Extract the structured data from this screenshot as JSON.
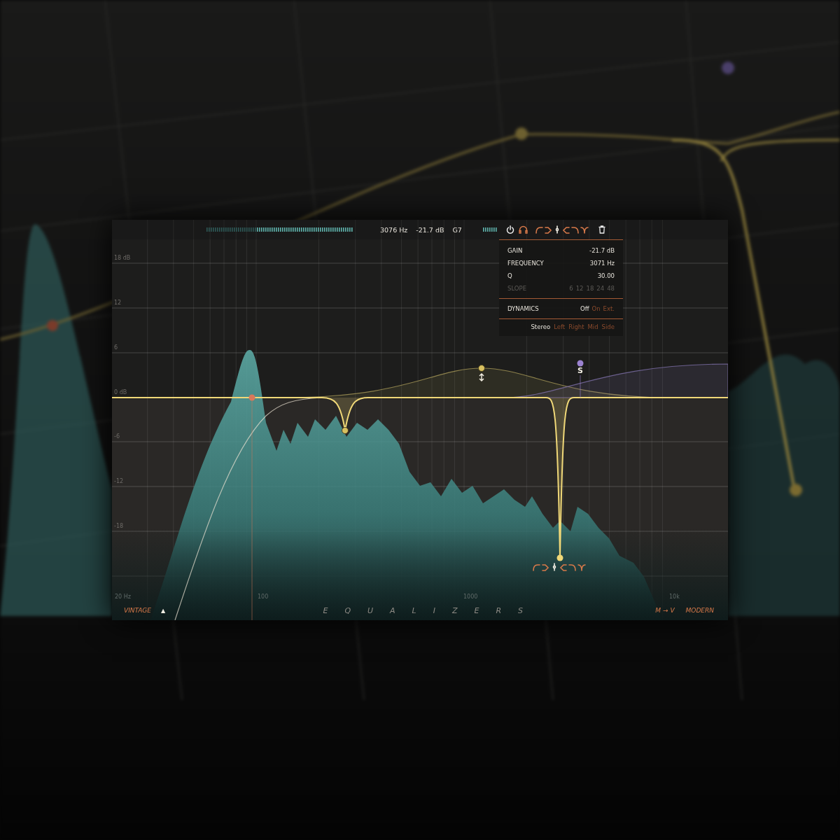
{
  "top_bar": {
    "readouts": [
      "3076 Hz",
      "-21.7 dB",
      "G7"
    ]
  },
  "filter_shapes": [
    {
      "kind": "low-cut",
      "selected": false
    },
    {
      "kind": "low-shelf",
      "selected": false
    },
    {
      "kind": "bell",
      "selected": true
    },
    {
      "kind": "high-shelf",
      "selected": false
    },
    {
      "kind": "high-cut",
      "selected": false
    },
    {
      "kind": "notch",
      "selected": false
    }
  ],
  "band_panel": {
    "rows": [
      {
        "label": "GAIN",
        "value": "-21.7 dB"
      },
      {
        "label": "FREQUENCY",
        "value": "3071 Hz"
      },
      {
        "label": "Q",
        "value": "30.00"
      }
    ],
    "slope": {
      "label": "SLOPE",
      "disabled": true,
      "options": [
        {
          "label": "6",
          "selected": false
        },
        {
          "label": "12",
          "selected": false
        },
        {
          "label": "18",
          "selected": false
        },
        {
          "label": "24",
          "selected": false
        },
        {
          "label": "48",
          "selected": false
        }
      ]
    },
    "dynamics": {
      "label": "DYNAMICS",
      "options": [
        {
          "label": "Off",
          "selected": true
        },
        {
          "label": "On",
          "selected": false
        },
        {
          "label": "Ext.",
          "selected": false
        }
      ]
    },
    "stereo": [
      {
        "label": "Stereo",
        "selected": true
      },
      {
        "label": "Left",
        "selected": false
      },
      {
        "label": "Right",
        "selected": false
      },
      {
        "label": "Mid",
        "selected": false
      },
      {
        "label": "Side",
        "selected": false
      }
    ]
  },
  "graph": {
    "y_labels": [
      "18 dB",
      "12",
      "6",
      "0 dB",
      "-6",
      "-12",
      "-18"
    ],
    "x_labels": [
      "20 Hz",
      "100",
      "1000",
      "10k"
    ],
    "side_marker": "S",
    "node_filter_shapes": [
      {
        "kind": "low-cut",
        "selected": false
      },
      {
        "kind": "low-shelf",
        "selected": false
      },
      {
        "kind": "bell",
        "selected": true
      },
      {
        "kind": "high-shelf",
        "selected": false
      },
      {
        "kind": "high-cut",
        "selected": false
      },
      {
        "kind": "notch",
        "selected": false
      }
    ]
  },
  "bottom_bar": {
    "left_mode": "VINTAGE",
    "toggle": "▲",
    "title": "EQUALIZERS",
    "switch": "M → V",
    "right_mode": "MODERN"
  }
}
